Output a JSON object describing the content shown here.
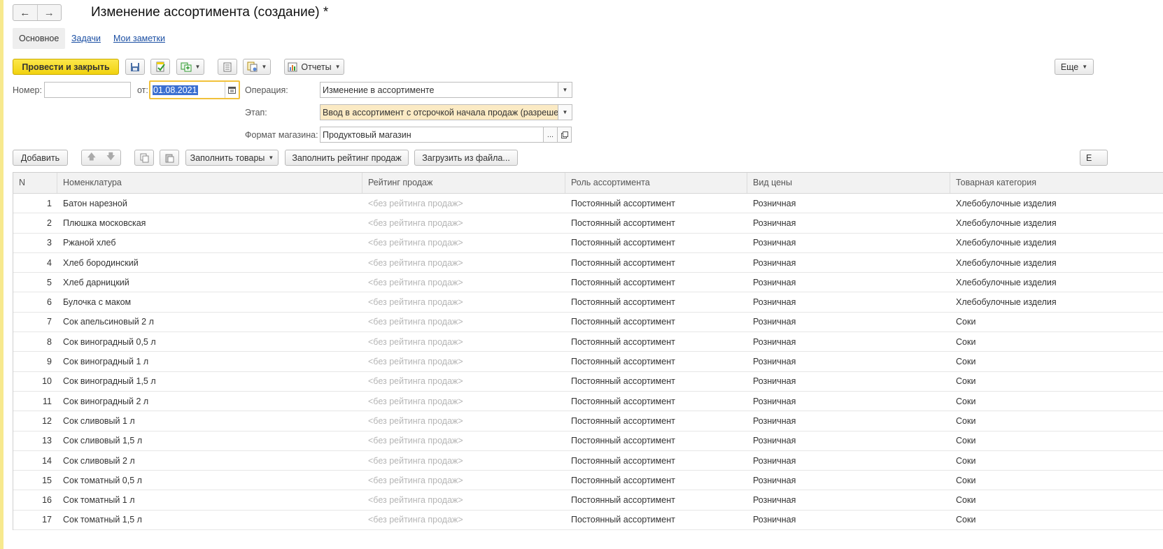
{
  "window": {
    "title": "Изменение ассортимента (создание) *",
    "back_icon": "arrow-left-icon",
    "forward_icon": "arrow-right-icon"
  },
  "tabs": [
    {
      "label": "Основное",
      "active": true
    },
    {
      "label": "Задачи",
      "active": false
    },
    {
      "label": "Мои заметки",
      "active": false
    }
  ],
  "toolbar": {
    "post_close": "Провести и закрыть",
    "reports": "Отчеты",
    "more": "Еще"
  },
  "form": {
    "number_label": "Номер:",
    "number_value": "",
    "date_label": "от:",
    "date_value": "01.08.2021",
    "operation_label": "Операция:",
    "operation_value": "Изменение в ассортименте",
    "stage_label": "Этап:",
    "stage_value": "Ввод в ассортимент с отсрочкой начала продаж (разрешен",
    "format_label": "Формат магазина:",
    "format_value": "Продуктовый магазин"
  },
  "table_toolbar": {
    "add": "Добавить",
    "fill_goods": "Заполнить товары",
    "fill_rating": "Заполнить рейтинг продаж",
    "load_file": "Загрузить из файла...",
    "cut_label": "Е"
  },
  "table": {
    "columns": [
      "N",
      "Номенклатура",
      "Рейтинг продаж",
      "Роль ассортимента",
      "Вид цены",
      "Товарная категория"
    ],
    "rows": [
      {
        "n": "1",
        "name": "Батон нарезной",
        "rating": "<без рейтинга продаж>",
        "role": "Постоянный ассортимент",
        "price": "Розничная",
        "cat": "Хлебобулочные изделия"
      },
      {
        "n": "2",
        "name": "Плюшка московская",
        "rating": "<без рейтинга продаж>",
        "role": "Постоянный ассортимент",
        "price": "Розничная",
        "cat": "Хлебобулочные изделия"
      },
      {
        "n": "3",
        "name": "Ржаной хлеб",
        "rating": "<без рейтинга продаж>",
        "role": "Постоянный ассортимент",
        "price": "Розничная",
        "cat": "Хлебобулочные изделия"
      },
      {
        "n": "4",
        "name": "Хлеб бородинский",
        "rating": "<без рейтинга продаж>",
        "role": "Постоянный ассортимент",
        "price": "Розничная",
        "cat": "Хлебобулочные изделия"
      },
      {
        "n": "5",
        "name": "Хлеб дарницкий",
        "rating": "<без рейтинга продаж>",
        "role": "Постоянный ассортимент",
        "price": "Розничная",
        "cat": "Хлебобулочные изделия"
      },
      {
        "n": "6",
        "name": "Булочка с маком",
        "rating": "<без рейтинга продаж>",
        "role": "Постоянный ассортимент",
        "price": "Розничная",
        "cat": "Хлебобулочные изделия"
      },
      {
        "n": "7",
        "name": "Сок апельсиновый 2 л",
        "rating": "<без рейтинга продаж>",
        "role": "Постоянный ассортимент",
        "price": "Розничная",
        "cat": "Соки"
      },
      {
        "n": "8",
        "name": "Сок виноградный 0,5 л",
        "rating": "<без рейтинга продаж>",
        "role": "Постоянный ассортимент",
        "price": "Розничная",
        "cat": "Соки"
      },
      {
        "n": "9",
        "name": "Сок виноградный 1 л",
        "rating": "<без рейтинга продаж>",
        "role": "Постоянный ассортимент",
        "price": "Розничная",
        "cat": "Соки"
      },
      {
        "n": "10",
        "name": "Сок виноградный 1,5 л",
        "rating": "<без рейтинга продаж>",
        "role": "Постоянный ассортимент",
        "price": "Розничная",
        "cat": "Соки"
      },
      {
        "n": "11",
        "name": "Сок виноградный 2 л",
        "rating": "<без рейтинга продаж>",
        "role": "Постоянный ассортимент",
        "price": "Розничная",
        "cat": "Соки"
      },
      {
        "n": "12",
        "name": "Сок сливовый 1 л",
        "rating": "<без рейтинга продаж>",
        "role": "Постоянный ассортимент",
        "price": "Розничная",
        "cat": "Соки"
      },
      {
        "n": "13",
        "name": "Сок сливовый 1,5 л",
        "rating": "<без рейтинга продаж>",
        "role": "Постоянный ассортимент",
        "price": "Розничная",
        "cat": "Соки"
      },
      {
        "n": "14",
        "name": "Сок сливовый 2 л",
        "rating": "<без рейтинга продаж>",
        "role": "Постоянный ассортимент",
        "price": "Розничная",
        "cat": "Соки"
      },
      {
        "n": "15",
        "name": "Сок томатный 0,5 л",
        "rating": "<без рейтинга продаж>",
        "role": "Постоянный ассортимент",
        "price": "Розничная",
        "cat": "Соки"
      },
      {
        "n": "16",
        "name": "Сок томатный 1 л",
        "rating": "<без рейтинга продаж>",
        "role": "Постоянный ассортимент",
        "price": "Розничная",
        "cat": "Соки"
      },
      {
        "n": "17",
        "name": "Сок томатный 1,5 л",
        "rating": "<без рейтинга продаж>",
        "role": "Постоянный ассортимент",
        "price": "Розничная",
        "cat": "Соки"
      }
    ]
  },
  "colors": {
    "primary_button": "#f1d20f",
    "stage_field_bg": "#fbeac4",
    "link": "#1b4fa3",
    "date_focus_border": "#f1c13b",
    "selection": "#3b6fd1"
  }
}
